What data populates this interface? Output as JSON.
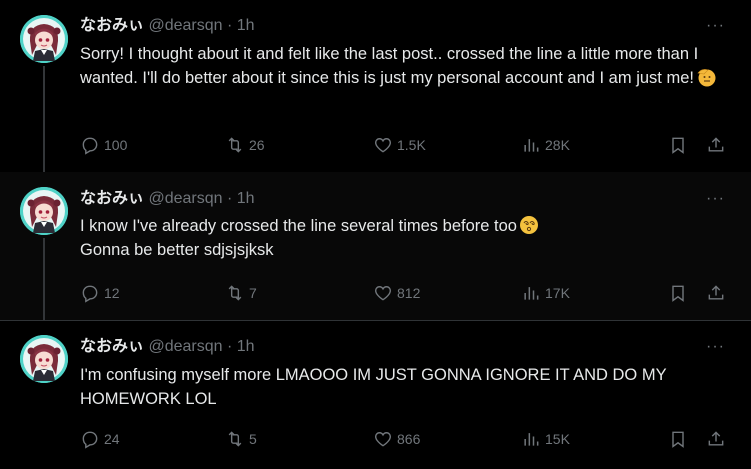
{
  "tweets": [
    {
      "name": "なおみぃ",
      "handle": "@dearsqn",
      "dot": "·",
      "time": "1h",
      "more": "···",
      "text": "Sorry! I thought about it and felt like the last post.. crossed the line a little more than I wanted. I'll do better about it since this is just my personal account and I am just me!",
      "emoji": "saluting-face",
      "replies": "100",
      "retweets": "26",
      "likes": "1.5K",
      "views": "28K"
    },
    {
      "name": "なおみぃ",
      "handle": "@dearsqn",
      "dot": "·",
      "time": "1h",
      "more": "···",
      "text_line1": "I know I've already crossed the line several times before too",
      "emoji": "dizzy-face",
      "text_line2": "Gonna be better sdjsjsjksk",
      "replies": "12",
      "retweets": "7",
      "likes": "812",
      "views": "17K"
    },
    {
      "name": "なおみぃ",
      "handle": "@dearsqn",
      "dot": "·",
      "time": "1h",
      "more": "···",
      "text": "I'm confusing myself more LMAOOO IM JUST GONNA IGNORE IT AND DO MY HOMEWORK LOL",
      "replies": "24",
      "retweets": "5",
      "likes": "866",
      "views": "15K"
    }
  ],
  "colors": {
    "background": "#000000",
    "text": "#e7e9ea",
    "muted": "#71767b",
    "avatar_bg": "#4fd2c7",
    "divider": "#2f3336"
  }
}
